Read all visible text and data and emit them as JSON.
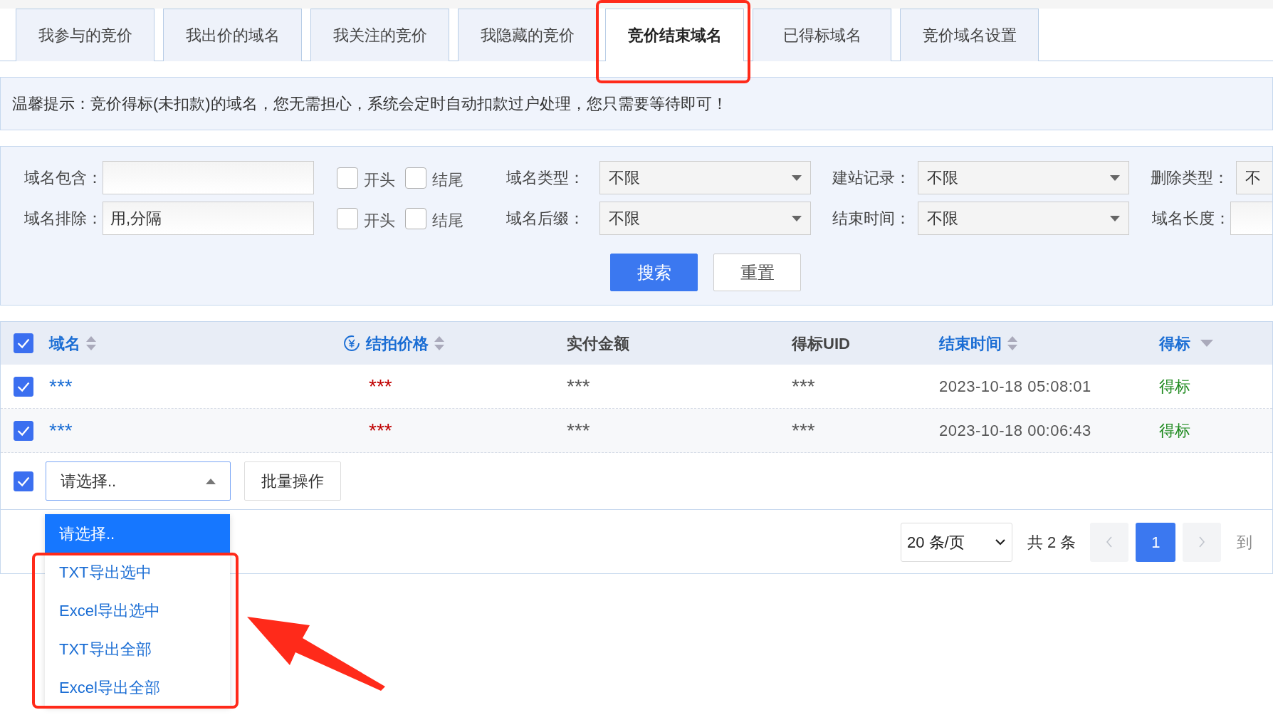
{
  "tabs": [
    {
      "label": "我参与的竞价",
      "selected": false
    },
    {
      "label": "我出价的域名",
      "selected": false
    },
    {
      "label": "我关注的竞价",
      "selected": false
    },
    {
      "label": "我隐藏的竞价",
      "selected": false
    },
    {
      "label": "竞价结束域名",
      "selected": true
    },
    {
      "label": "已得标域名",
      "selected": false
    },
    {
      "label": "竞价域名设置",
      "selected": false
    }
  ],
  "notice": "温馨提示：竞价得标(未扣款)的域名，您无需担心，系统会定时自动扣款过户处理，您只需要等待即可！",
  "filters": [
    [
      {
        "kind": "text",
        "label": "域名包含："
      },
      {
        "kind": "checkbox",
        "label": "开头",
        "checked": false
      },
      {
        "kind": "checkbox",
        "label": "结尾",
        "checked": false
      },
      {
        "kind": "select",
        "label": "域名类型：",
        "value": "不限"
      },
      {
        "kind": "select",
        "label": "建站记录：",
        "value": "不限"
      },
      {
        "kind": "select",
        "label": "删除类型：",
        "value": "不"
      }
    ],
    [
      {
        "kind": "text",
        "label": "域名排除：",
        "placeholder": "用,分隔"
      },
      {
        "kind": "checkbox",
        "label": "开头",
        "checked": false
      },
      {
        "kind": "checkbox",
        "label": "结尾",
        "checked": false
      },
      {
        "kind": "select",
        "label": "域名后缀：",
        "value": "不限"
      },
      {
        "kind": "select",
        "label": "结束时间：",
        "value": "不限"
      },
      {
        "kind": "text",
        "label": "域名长度："
      }
    ]
  ],
  "filter_buttons": [
    {
      "label": "搜索",
      "kind": "primary"
    },
    {
      "label": "重置",
      "kind": "default"
    }
  ],
  "table": {
    "header_checked": true,
    "columns": [
      {
        "label": "域名",
        "kind": "sort"
      },
      {
        "label": "结拍价格",
        "kind": "price-sort"
      },
      {
        "label": "实付金额",
        "kind": "plain"
      },
      {
        "label": "得标UID",
        "kind": "plain"
      },
      {
        "label": "结束时间",
        "kind": "sort"
      },
      {
        "label": "得标",
        "kind": "filter"
      }
    ],
    "rows": [
      {
        "checked": true,
        "domain": "***",
        "price": "***",
        "paid": "***",
        "uid": "***",
        "end_time": "2023-10-18 05:08:01",
        "status": "得标"
      },
      {
        "checked": true,
        "domain": "***",
        "price": "***",
        "paid": "***",
        "uid": "***",
        "end_time": "2023-10-18 00:06:43",
        "status": "得标"
      }
    ]
  },
  "bulk": {
    "checked": true,
    "select": "请选择..",
    "expanded": true,
    "button": "批量操作",
    "options": [
      {
        "label": "请选择..",
        "selected": true
      },
      {
        "label": "TXT导出选中",
        "selected": false
      },
      {
        "label": "Excel导出选中",
        "selected": false
      },
      {
        "label": "TXT导出全部",
        "selected": false
      },
      {
        "label": "Excel导出全部",
        "selected": false
      }
    ]
  },
  "pagination": {
    "page_size": "20 条/页",
    "total": "共 2 条",
    "prev_disabled": true,
    "next_disabled": true,
    "pages": [
      {
        "label": "1",
        "selected": true
      }
    ],
    "goto": "到"
  }
}
